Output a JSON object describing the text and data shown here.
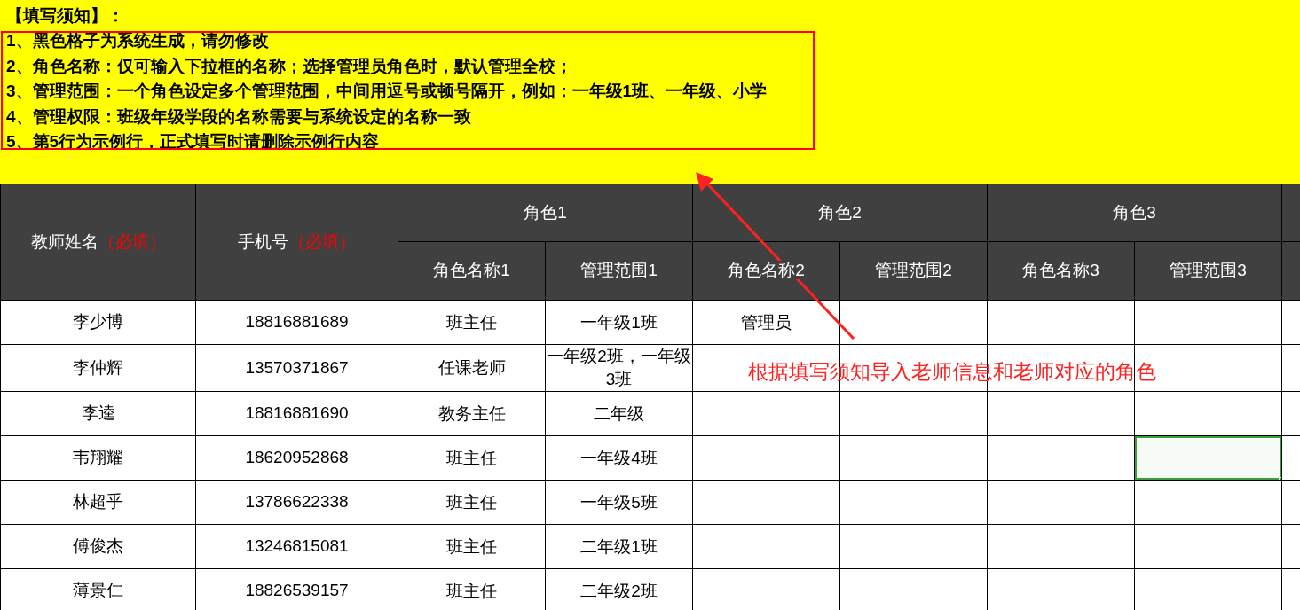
{
  "notice": {
    "title": "【填写须知】：",
    "lines": [
      "1、黑色格子为系统生成，请勿修改",
      "2、角色名称：仅可输入下拉框的名称；选择管理员角色时，默认管理全校；",
      "3、管理范围：一个角色设定多个管理范围，中间用逗号或顿号隔开，例如：一年级1班、一年级、小学",
      "4、管理权限：班级年级学段的名称需要与系统设定的名称一致",
      "5、第5行为示例行，正式填写时请删除示例行内容"
    ]
  },
  "header": {
    "teacher_name": {
      "label": "教师姓名",
      "required": "（必填）"
    },
    "phone": {
      "label": "手机号",
      "required": "（必填）"
    },
    "role_groups": [
      {
        "title": "角色1",
        "columns": [
          "角色名称1",
          "管理范围1"
        ]
      },
      {
        "title": "角色2",
        "columns": [
          "角色名称2",
          "管理范围2"
        ]
      },
      {
        "title": "角色3",
        "columns": [
          "角色名称3",
          "管理范围3"
        ]
      }
    ]
  },
  "rows": [
    {
      "name": "李少博",
      "phone": "18816881689",
      "cells": [
        {
          "text": "班主任",
          "selected": false
        },
        {
          "text": "一年级1班",
          "selected": false
        },
        {
          "text": "管理员",
          "selected": false
        },
        {
          "selected": false
        },
        {
          "selected": false
        },
        {
          "selected": false
        }
      ]
    },
    {
      "name": "李仲辉",
      "phone": "13570371867",
      "cells": [
        {
          "text": "任课老师",
          "selected": false
        },
        {
          "text": "一年级2班，一年级3班",
          "selected": false
        },
        {
          "selected": false
        },
        {
          "selected": false
        },
        {
          "selected": false
        },
        {
          "selected": false
        }
      ]
    },
    {
      "name": "李逵",
      "phone": "18816881690",
      "cells": [
        {
          "text": "教务主任",
          "selected": false
        },
        {
          "text": "二年级",
          "selected": false
        },
        {
          "selected": false
        },
        {
          "selected": false
        },
        {
          "selected": false
        },
        {
          "selected": false
        }
      ]
    },
    {
      "name": "韦翔耀",
      "phone": "18620952868",
      "cells": [
        {
          "text": "班主任",
          "selected": false
        },
        {
          "text": "一年级4班",
          "selected": false
        },
        {
          "selected": false
        },
        {
          "selected": false
        },
        {
          "selected": false
        },
        {
          "selected": true
        }
      ]
    },
    {
      "name": "林超乎",
      "phone": "13786622338",
      "cells": [
        {
          "text": "班主任",
          "selected": false
        },
        {
          "text": "一年级5班",
          "selected": false
        },
        {
          "selected": false
        },
        {
          "selected": false
        },
        {
          "selected": false
        },
        {
          "selected": false
        }
      ]
    },
    {
      "name": "傅俊杰",
      "phone": "13246815081",
      "cells": [
        {
          "text": "班主任",
          "selected": false
        },
        {
          "text": "二年级1班",
          "selected": false
        },
        {
          "selected": false
        },
        {
          "selected": false
        },
        {
          "selected": false
        },
        {
          "selected": false
        }
      ]
    },
    {
      "name": "薄景仁",
      "phone": "18826539157",
      "cells": [
        {
          "text": "班主任",
          "selected": false
        },
        {
          "text": "二年级2班",
          "selected": false
        },
        {
          "selected": false
        },
        {
          "selected": false
        },
        {
          "selected": false
        },
        {
          "selected": false
        }
      ]
    }
  ],
  "annotation": {
    "text": "根据填写须知导入老师信息和老师对应的角色"
  }
}
